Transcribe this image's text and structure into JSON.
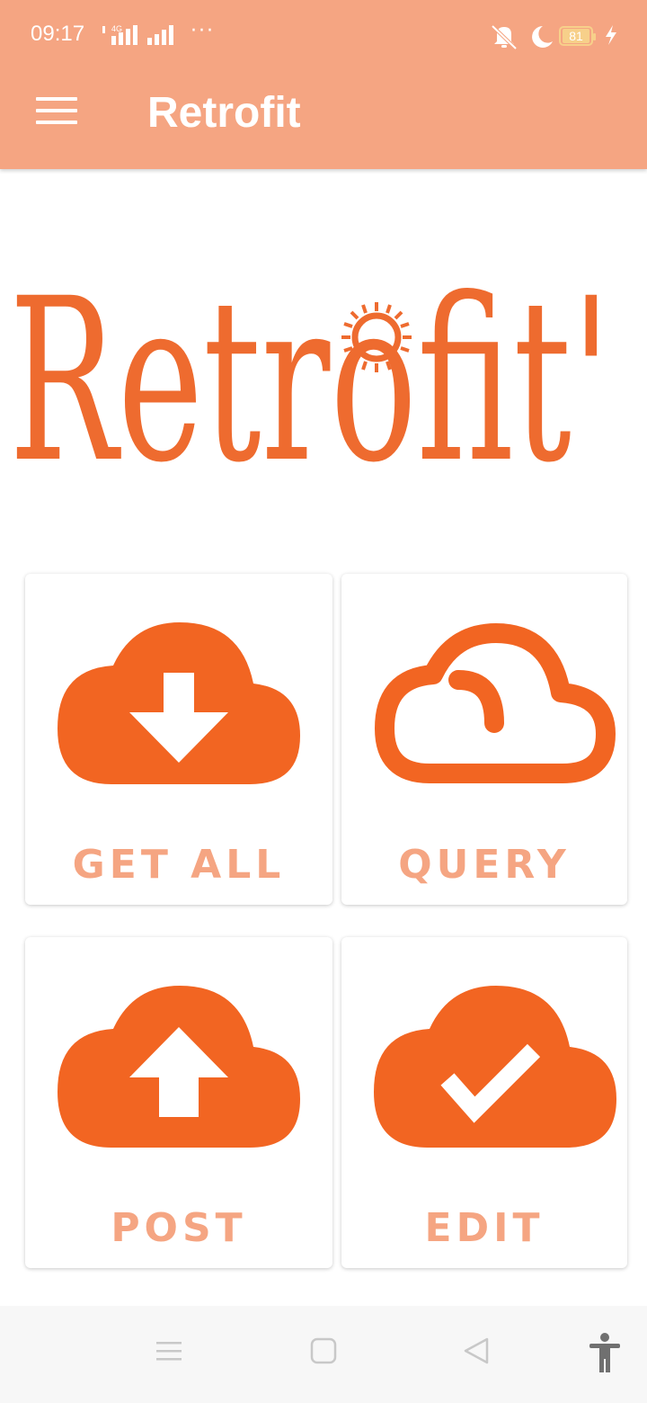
{
  "status_bar": {
    "time": "09:17",
    "network": "4G",
    "more": "···",
    "battery": "81",
    "icons": [
      "signal-icon",
      "signal-icon",
      "mute-icon",
      "moon-icon",
      "battery-icon",
      "charging-icon"
    ]
  },
  "app_bar": {
    "menu_icon": "hamburger-icon",
    "title": "Retrofit"
  },
  "logo": {
    "text": "Retrofit'"
  },
  "cards": [
    {
      "label": "GET ALL",
      "icon": "cloud-download-icon"
    },
    {
      "label": "QUERY",
      "icon": "cloud-outline-icon"
    },
    {
      "label": "POST",
      "icon": "cloud-upload-icon"
    },
    {
      "label": "EDIT",
      "icon": "cloud-check-icon"
    }
  ],
  "nav_bar": {
    "icons": [
      "recents-icon",
      "home-icon",
      "back-icon",
      "accessibility-icon"
    ]
  },
  "colors": {
    "primary": "#f5a582",
    "accent": "#ee6b2f",
    "icon": "#f26522"
  }
}
